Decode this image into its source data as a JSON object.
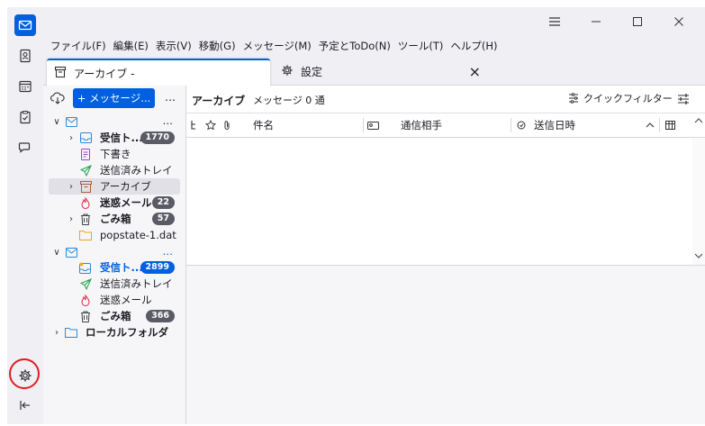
{
  "window": {
    "controls": {
      "menu_icon": "hamburger-icon",
      "minimize": "minimize-icon",
      "maximize": "maximize-icon",
      "close": "close-icon"
    }
  },
  "menubar": {
    "items": [
      "ファイル(F)",
      "編集(E)",
      "表示(V)",
      "移動(G)",
      "メッセージ(M)",
      "予定とToDo(N)",
      "ツール(T)",
      "ヘルプ(H)"
    ]
  },
  "tabs": [
    {
      "label": "アーカイブ -",
      "icon": "archive-icon",
      "active": true
    },
    {
      "label": "設定",
      "icon": "gear-icon",
      "active": false
    }
  ],
  "tab_close": "×",
  "folder_pane": {
    "new_message_label": "+ メッセージ...",
    "more_label": "…",
    "account1": {
      "more": "…",
      "folders": [
        {
          "name": "受信ト...",
          "badge": "1770",
          "bold": true,
          "icon": "inbox-icon"
        },
        {
          "name": "下書き",
          "icon": "draft-icon"
        },
        {
          "name": "送信済みトレイ",
          "icon": "sent-icon"
        },
        {
          "name": "アーカイブ",
          "icon": "archive-icon",
          "selected": true
        },
        {
          "name": "迷惑メール",
          "badge": "22",
          "bold": true,
          "icon": "junk-icon"
        },
        {
          "name": "ごみ箱",
          "badge": "57",
          "bold": true,
          "icon": "trash-icon"
        },
        {
          "name": "popstate-1.dat",
          "icon": "folder-icon"
        }
      ]
    },
    "account2": {
      "more": "…",
      "folders": [
        {
          "name": "受信ト...",
          "badge": "2899",
          "bold": true,
          "icon": "inbox-icon",
          "blue": true
        },
        {
          "name": "送信済みトレイ",
          "icon": "sent-icon"
        },
        {
          "name": "迷惑メール",
          "icon": "junk-icon"
        },
        {
          "name": "ごみ箱",
          "badge": "366",
          "bold": true,
          "icon": "trash-icon"
        }
      ]
    },
    "local_folders": "ローカルフォルダ"
  },
  "thread_header": {
    "folder_name": "アーカイブ",
    "message_count": "メッセージ 0 通",
    "quick_filter_label": "クイックフィルター"
  },
  "columns": {
    "subject": "件名",
    "correspondent": "通信相手",
    "date": "送信日時",
    "sort_indicator": "^"
  },
  "colors": {
    "accent": "#0060df",
    "highlight_circle": "#e01b24"
  }
}
